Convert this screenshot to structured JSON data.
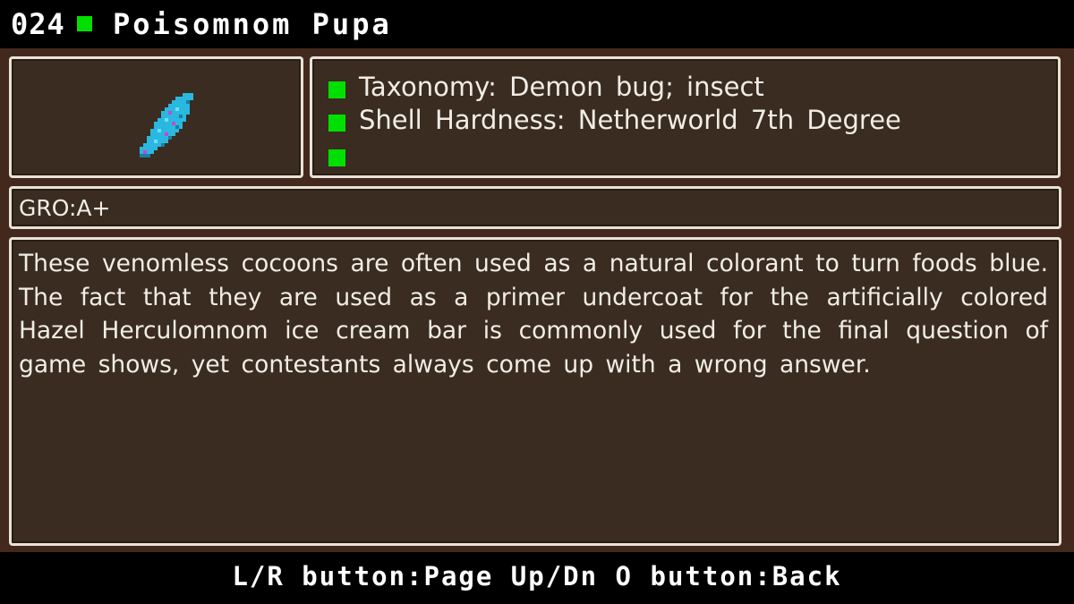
{
  "header": {
    "number": "024",
    "name": "Poisomnom Pupa"
  },
  "sprite": {
    "icon": "blue-pupa-sprite",
    "color": "#2bb8e0"
  },
  "info": {
    "rows": [
      "Taxonomy: Demon bug; insect",
      "Shell Hardness: Netherworld 7th Degree",
      ""
    ],
    "bullet_color": "#00e000"
  },
  "rating": "GRO:A+",
  "description": "These venomless cocoons are often used as a natural colorant to turn foods blue. The fact that they are used as a primer undercoat for the artificially colored Hazel Herculomnom ice cream bar is commonly used for the final question of game shows, yet contestants always come up with a wrong answer.",
  "footer": {
    "controls": "L/R button:Page Up/Dn O button:Back"
  }
}
